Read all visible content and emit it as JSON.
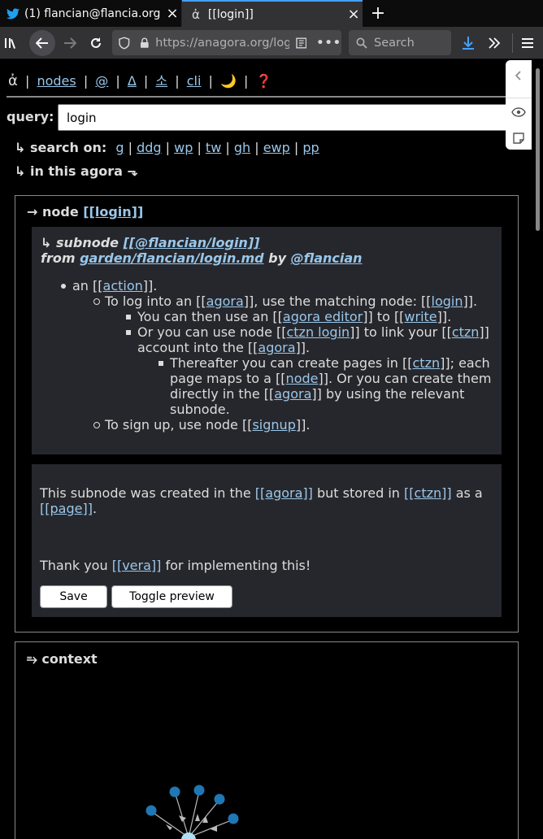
{
  "browser": {
    "tabs": [
      {
        "title": "(1) flancian@flancia.org",
        "icon": "twitter-bird-icon"
      },
      {
        "title": "[[login]]",
        "icon": "agora-icon"
      }
    ],
    "url": "https://anagora.org/login",
    "url_display": "https://anagora.org/log",
    "search_placeholder": "Search"
  },
  "topnav": {
    "logo": "ἀ",
    "sep": "|",
    "links": [
      "nodes",
      "@",
      "Δ",
      "소",
      "cli"
    ],
    "moon": "🌙",
    "help": "❓"
  },
  "query": {
    "label": "query:",
    "value": "login"
  },
  "search_on": {
    "label": "↳ search on:",
    "engines": [
      "g",
      "ddg",
      "wp",
      "tw",
      "gh",
      "ewp",
      "pp"
    ]
  },
  "in_this_agora": "↳ in this agora ⬎",
  "node": {
    "prefix": "→ node ",
    "name": "[[login]]"
  },
  "subnode": {
    "prefix": "↳ subnode ",
    "name": "[[@flancian/login]]",
    "from": "from ",
    "path": "garden/flancian/login.md",
    "by": " by ",
    "user": "@flancian"
  },
  "content": {
    "l1a": "an [[",
    "l1b": "action",
    "l1c": "]].",
    "l2a": "To log into an [[",
    "l2b": "agora",
    "l2c": "]], use the matching node: [[",
    "l2d": "login",
    "l2e": "]].",
    "l3a": "You can then use an [[",
    "l3b": "agora editor",
    "l3c": "]] to [[",
    "l3d": "write",
    "l3e": "]].",
    "l4a": "Or you can use node [[",
    "l4b": "ctzn login",
    "l4c": "]] to link your [[",
    "l4d": "ctzn",
    "l4e": "]]",
    "l4f": "account into the [[",
    "l4g": "agora",
    "l4h": "]].",
    "l5a": "Thereafter you can create pages in [[",
    "l5b": "ctzn",
    "l5c": "]]; each",
    "l5d": "page maps to a [[",
    "l5e": "node",
    "l5f": "]]. Or you can create them",
    "l5g": "directly in the [[",
    "l5h": "agora",
    "l5i": "]] by using the relevant",
    "l5j": "subnode.",
    "l6a": "To sign up, use node [[",
    "l6b": "signup",
    "l6c": "]]."
  },
  "editor": {
    "t1a": "This subnode was created in the ",
    "t1b": "[[agora]]",
    "t1c": " but stored in ",
    "t1d": "[[ctzn]]",
    "t1e": " as a",
    "t2": "[[page]]",
    "t2b": ".",
    "t3a": "Thank you ",
    "t3b": "[[vera]]",
    "t3c": " for implementing this!",
    "save": "Save",
    "toggle": "Toggle preview"
  },
  "context": {
    "title": "⥱ context"
  },
  "colors": {
    "link": "#9ac7ea",
    "graph_node": "#1f77b4",
    "panel": "#26272c"
  }
}
